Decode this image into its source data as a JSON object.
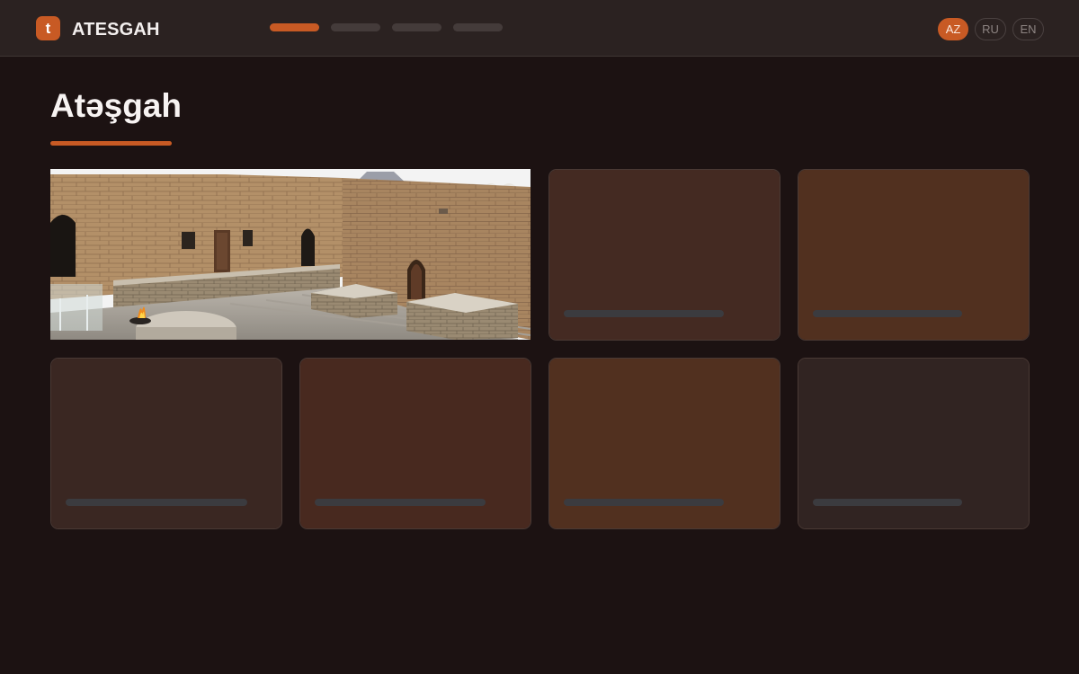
{
  "header": {
    "logo_letter": "t",
    "brand": "ATESGAH",
    "nav_items": [
      {
        "id": "nav-1",
        "active": true
      },
      {
        "id": "nav-2",
        "active": false
      },
      {
        "id": "nav-3",
        "active": false
      },
      {
        "id": "nav-4",
        "active": false
      }
    ],
    "languages": [
      {
        "code": "AZ",
        "active": true
      },
      {
        "code": "RU",
        "active": false
      },
      {
        "code": "EN",
        "active": false
      }
    ]
  },
  "main": {
    "title": "Atəşgah"
  },
  "colors": {
    "accent": "#c85a24",
    "background": "#1c1212",
    "header": "#2b2221",
    "placeholder_bar": "#3b3b3f",
    "card_dark_brown": "#442a22",
    "card_brown": "#51301f",
    "card_mid_brown": "#48291f",
    "card_charcoal": "#312422",
    "card_taupe": "#3a2722"
  },
  "gallery": {
    "hero_image": "fire-temple-courtyard-photo",
    "cards": [
      {
        "id": "card-1",
        "color": "#442a22",
        "state": "loading"
      },
      {
        "id": "card-2",
        "color": "#51301f",
        "state": "loading"
      },
      {
        "id": "card-3",
        "color": "#3a2722",
        "state": "loading"
      },
      {
        "id": "card-4",
        "color": "#48291f",
        "state": "loading"
      },
      {
        "id": "card-5",
        "color": "#51301f",
        "state": "loading"
      },
      {
        "id": "card-6",
        "color": "#312422",
        "state": "loading"
      }
    ]
  }
}
